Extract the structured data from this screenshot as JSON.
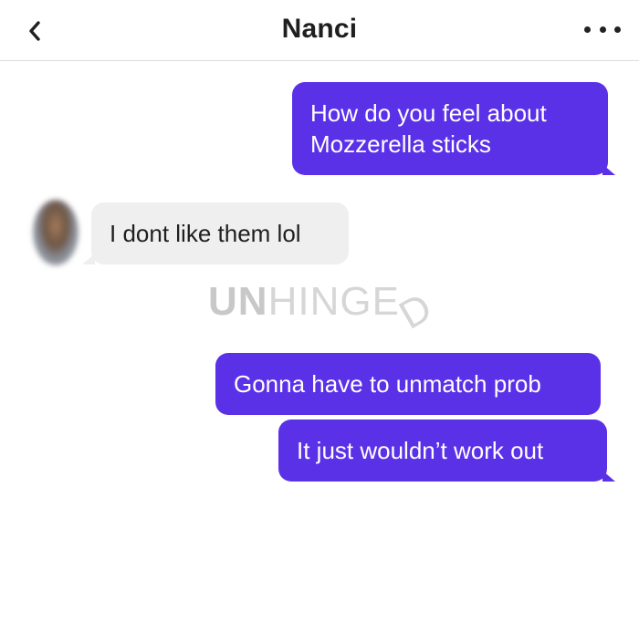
{
  "header": {
    "back_icon": "chevron-left-icon",
    "title": "Nanci",
    "more_icon": "more-horizontal-icon"
  },
  "messages": [
    {
      "direction": "outgoing",
      "text": "How do you feel about Mozzerella sticks"
    },
    {
      "direction": "incoming",
      "text": "I dont like them lol"
    },
    {
      "direction": "outgoing",
      "text": "Gonna have to unmatch prob"
    },
    {
      "direction": "outgoing",
      "text": "It just wouldn’t work out"
    }
  ],
  "watermark": {
    "bold_part": "UN",
    "light_part": "HINGE",
    "tilted_part": "D"
  },
  "colors": {
    "outgoing_bubble": "#5b31e8",
    "incoming_bubble": "#efefef",
    "watermark": "#cfcfcf"
  }
}
